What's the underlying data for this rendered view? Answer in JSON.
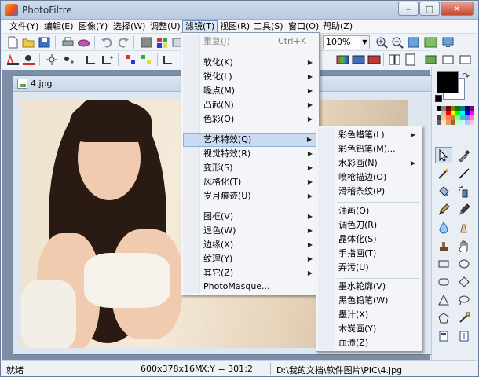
{
  "window": {
    "title": "PhotoFiltre"
  },
  "menubar": [
    {
      "label": "文件(Y)",
      "name": "file"
    },
    {
      "label": "编辑(E)",
      "name": "edit"
    },
    {
      "label": "图像(Y)",
      "name": "image"
    },
    {
      "label": "选择(W)",
      "name": "select"
    },
    {
      "label": "调整(U)",
      "name": "adjust"
    },
    {
      "label": "滤镜(T)",
      "name": "filter"
    },
    {
      "label": "视图(R)",
      "name": "view"
    },
    {
      "label": "工具(S)",
      "name": "tools"
    },
    {
      "label": "窗口(O)",
      "name": "window"
    },
    {
      "label": "帮助(Z)",
      "name": "help"
    }
  ],
  "toolbar": {
    "zoom": "100%"
  },
  "document": {
    "title": "4.jpg"
  },
  "filter_menu": {
    "items": [
      {
        "label": "重复(J)",
        "shortcut": "Ctrl+K",
        "disabled": true
      },
      {
        "label": "软化(K)",
        "submenu": true
      },
      {
        "label": "锐化(L)",
        "submenu": true
      },
      {
        "label": "噪点(M)",
        "submenu": true
      },
      {
        "label": "凸起(N)",
        "submenu": true
      },
      {
        "label": "色彩(O)",
        "submenu": true
      },
      {
        "label": "艺术特效(Q)",
        "submenu": true,
        "highlighted": true
      },
      {
        "label": "视觉特效(R)",
        "submenu": true
      },
      {
        "label": "变形(S)",
        "submenu": true
      },
      {
        "label": "风格化(T)",
        "submenu": true
      },
      {
        "label": "岁月痕迹(U)",
        "submenu": true
      },
      {
        "label": "图框(V)",
        "submenu": true
      },
      {
        "label": "退色(W)",
        "submenu": true
      },
      {
        "label": "边缘(X)",
        "submenu": true
      },
      {
        "label": "纹理(Y)",
        "submenu": true
      },
      {
        "label": "其它(Z)",
        "submenu": true
      },
      {
        "label": "PhotoMasque..."
      }
    ]
  },
  "art_submenu": {
    "items": [
      {
        "label": "彩色蜡笔(L)",
        "submenu": true
      },
      {
        "label": "彩色铅笔(M)..."
      },
      {
        "label": "水彩画(N)",
        "submenu": true
      },
      {
        "label": "喷枪描边(O)"
      },
      {
        "label": "滑稽条纹(P)"
      },
      {
        "label": "油画(Q)"
      },
      {
        "label": "调色刀(R)"
      },
      {
        "label": "晶体化(S)"
      },
      {
        "label": "手指画(T)"
      },
      {
        "label": "弄污(U)"
      },
      {
        "label": "墨水轮廓(V)"
      },
      {
        "label": "黑色铅笔(W)"
      },
      {
        "label": "墨汁(X)"
      },
      {
        "label": "木炭画(Y)"
      },
      {
        "label": "血渍(Z)"
      }
    ]
  },
  "status": {
    "state": "就绪",
    "size": "600x378x16M",
    "coords": "X:Y = 301:2",
    "path": "D:\\我的文档\\软件图片\\PIC\\4.jpg"
  },
  "colors": {
    "foreground": "#000000",
    "background": "#ffffff"
  }
}
